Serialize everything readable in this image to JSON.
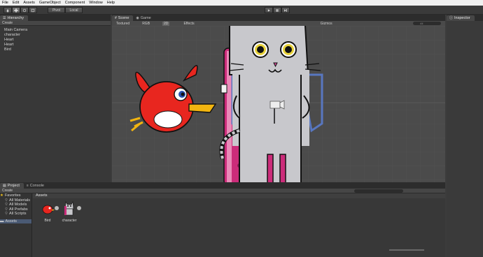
{
  "menu": [
    "File",
    "Edit",
    "Assets",
    "GameObject",
    "Component",
    "Window",
    "Help"
  ],
  "toolbar": {
    "tools": [
      "hand",
      "move",
      "rotate",
      "scale"
    ],
    "pivot_label": "Pivot",
    "local_label": "Local"
  },
  "hierarchy": {
    "tab_label": "Hierarchy",
    "create_label": "Create",
    "items": [
      "Main Camera",
      "character",
      "Heart",
      "Heart",
      "Bird"
    ]
  },
  "scene": {
    "tab_label": "Scene",
    "game_tab_label": "Game",
    "shading_mode": "Textured",
    "render_mode": "RGB",
    "twod_label": "2D",
    "effects_label": "Effects",
    "gizmos_label": "Gizmos",
    "search_label": "All"
  },
  "inspector": {
    "tab_label": "Inspector"
  },
  "project": {
    "tab_label": "Project",
    "console_tab_label": "Console",
    "create_label": "Create",
    "favorites_label": "Favorites",
    "favorites": [
      "All Materials",
      "All Models",
      "All Prefabs",
      "All Scripts"
    ],
    "assets_folder_label": "Assets",
    "breadcrumb": "Assets",
    "assets": [
      {
        "name": "Bird",
        "icon": "bird-thumbnail"
      },
      {
        "name": "character",
        "icon": "character-thumbnail"
      }
    ]
  },
  "colors": {
    "bird_red": "#e8261f",
    "cat_gray": "#c8c8cc",
    "pillar_pink": "#cc2c7a",
    "strap_blue": "#6a88c8"
  }
}
